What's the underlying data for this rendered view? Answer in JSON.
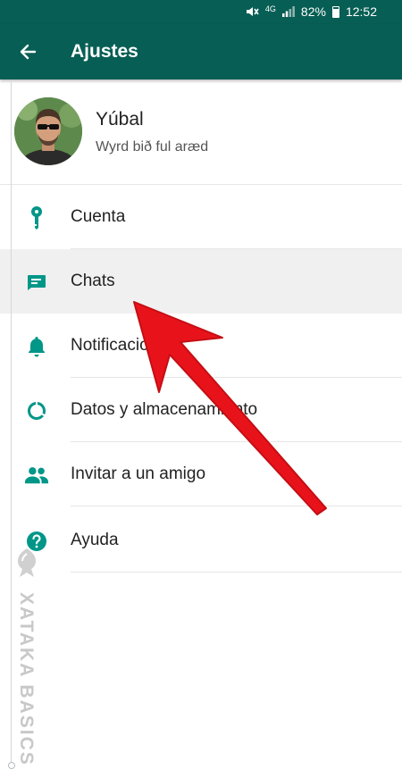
{
  "status_bar": {
    "network": "4G",
    "battery": "82%",
    "time": "12:52"
  },
  "app_bar": {
    "title": "Ajustes"
  },
  "profile": {
    "name": "Yúbal",
    "status": "Wyrd bið ful aræd"
  },
  "menu": [
    {
      "label": "Cuenta",
      "icon": "key-icon"
    },
    {
      "label": "Chats",
      "icon": "chat-icon"
    },
    {
      "label": "Notificaciones",
      "icon": "bell-icon"
    },
    {
      "label": "Datos y almacenamiento",
      "icon": "data-usage-icon"
    },
    {
      "label": "Invitar a un amigo",
      "icon": "people-icon"
    },
    {
      "label": "Ayuda",
      "icon": "help-icon"
    }
  ],
  "watermark": {
    "text": "XATAKA BASICS"
  },
  "colors": {
    "primary": "#075e54",
    "accent": "#009688",
    "arrow": "#e8131a"
  }
}
